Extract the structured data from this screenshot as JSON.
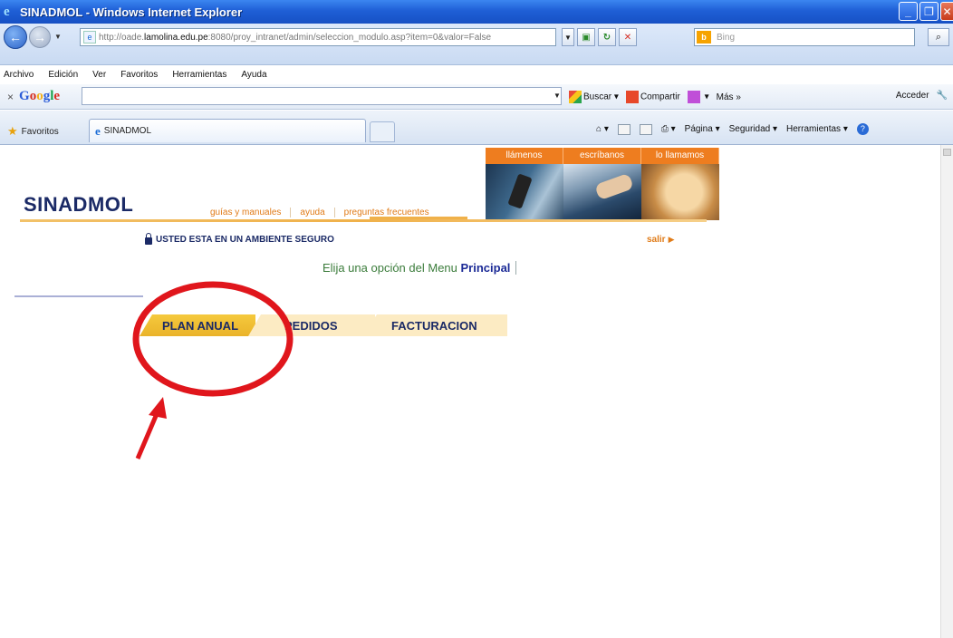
{
  "window": {
    "title": "SINADMOL - Windows Internet Explorer"
  },
  "address": {
    "url_prefix": "http://oade.",
    "url_domain": "lamolina.edu.pe",
    "url_rest": ":8080/proy_intranet/admin/seleccion_modulo.asp?item=0&valor=False",
    "search_placeholder": "Bing"
  },
  "menu": [
    "Archivo",
    "Edición",
    "Ver",
    "Favoritos",
    "Herramientas",
    "Ayuda"
  ],
  "google_toolbar": {
    "buscar": "Buscar",
    "compartir": "Compartir",
    "mas": "Más »",
    "acceder": "Acceder"
  },
  "favorites": {
    "label": "Favoritos"
  },
  "tab": {
    "title": "SINADMOL"
  },
  "command_bar": {
    "pagina": "Página",
    "seguridad": "Seguridad",
    "herramientas": "Herramientas"
  },
  "page": {
    "brand": "SINADMOL",
    "top_links": [
      "guías y manuales",
      "ayuda",
      "preguntas frecuentes"
    ],
    "banner_links": [
      "llámenos",
      "escríbanos",
      "lo llamamos"
    ],
    "secure_text": "USTED ESTA EN UN AMBIENTE SEGURO",
    "salir": "salir",
    "prompt": "Elija una opción del Menu",
    "prompt_bold": "Principal",
    "tabs": [
      "PLAN ANUAL",
      "PEDIDOS",
      "FACTURACION"
    ]
  },
  "annotation_color": "#e0161c"
}
